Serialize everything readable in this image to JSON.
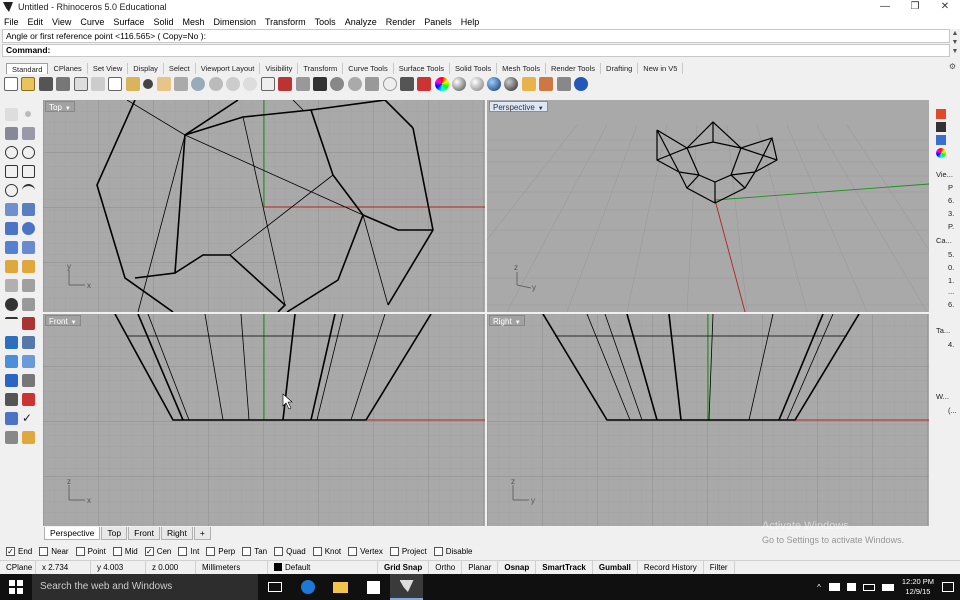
{
  "window": {
    "title": "Untitled - Rhinoceros 5.0 Educational",
    "buttons": [
      "—",
      "❐",
      "✕"
    ]
  },
  "menu": [
    "File",
    "Edit",
    "View",
    "Curve",
    "Surface",
    "Solid",
    "Mesh",
    "Dimension",
    "Transform",
    "Tools",
    "Analyze",
    "Render",
    "Panels",
    "Help"
  ],
  "command": {
    "history": "Angle or first reference point <116.565> ( Copy=No ):",
    "prompt": "Command:"
  },
  "toolbar_tabs": [
    "Standard",
    "CPlanes",
    "Set View",
    "Display",
    "Select",
    "Viewport Layout",
    "Visibility",
    "Transform",
    "Curve Tools",
    "Surface Tools",
    "Solid Tools",
    "Mesh Tools",
    "Render Tools",
    "Drafting",
    "New in V5"
  ],
  "viewports": {
    "top": "Top",
    "perspective": "Perspective",
    "front": "Front",
    "right": "Right"
  },
  "viewport_tabs": [
    "Perspective",
    "Top",
    "Front",
    "Right",
    "+"
  ],
  "right_panel": [
    "Vie...",
    "P",
    "6.",
    "3.",
    "P.",
    "Ca...",
    "5.",
    "0.",
    "1.",
    "...",
    "6.",
    "Ta...",
    "4.",
    "W...",
    "(..."
  ],
  "osnaps": [
    {
      "label": "End",
      "checked": true
    },
    {
      "label": "Near",
      "checked": false
    },
    {
      "label": "Point",
      "checked": false
    },
    {
      "label": "Mid",
      "checked": false
    },
    {
      "label": "Cen",
      "checked": true
    },
    {
      "label": "Int",
      "checked": false
    },
    {
      "label": "Perp",
      "checked": false
    },
    {
      "label": "Tan",
      "checked": false
    },
    {
      "label": "Quad",
      "checked": false
    },
    {
      "label": "Knot",
      "checked": false
    },
    {
      "label": "Vertex",
      "checked": false
    },
    {
      "label": "Project",
      "checked": false
    },
    {
      "label": "Disable",
      "checked": false
    }
  ],
  "activation": {
    "line1": "Activate Windows",
    "line2": "Go to Settings to activate Windows."
  },
  "status": {
    "cplane": "CPlane",
    "x": "x 2.734",
    "y": "y 4.003",
    "z": "z 0.000",
    "units": "Millimeters",
    "layer": "Default",
    "grid_snap": "Grid Snap",
    "ortho": "Ortho",
    "planar": "Planar",
    "osnap": "Osnap",
    "smarttrack": "SmartTrack",
    "gumball": "Gumball",
    "record_history": "Record History",
    "filter": "Filter"
  },
  "taskbar": {
    "search_placeholder": "Search the web and Windows",
    "time": "12:20 PM",
    "date": "12/9/15"
  },
  "colors": {
    "viewport_bg": "#a9a9a9",
    "grid_line": "#9c9c9c",
    "x_axis": "#b22222",
    "y_axis": "#1f8f1f",
    "taskbar": "#101010"
  }
}
